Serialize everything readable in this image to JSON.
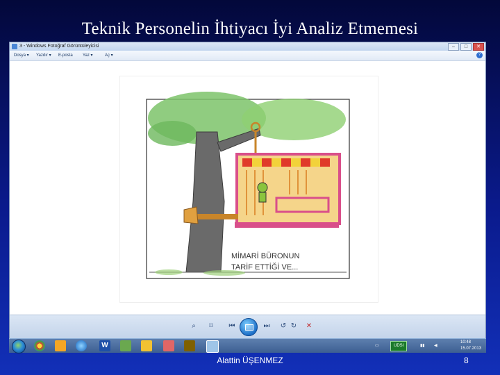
{
  "slide": {
    "title": "Teknik Personelin İhtiyacı İyi Analiz Etmemesi",
    "author": "Alattin ÜŞENMEZ",
    "page_number": "8"
  },
  "window": {
    "title": "3 - Windows Fotoğraf Görüntüleyicisi",
    "menu": [
      {
        "label": "Dosya ▾"
      },
      {
        "label": "Yazdır ▾"
      },
      {
        "label": "E-posta"
      },
      {
        "label": "Yaz ▾"
      },
      {
        "label": "Aç ▾"
      }
    ]
  },
  "photo": {
    "caption_line1": "MİMARİ BÜRONUN",
    "caption_line2": "TARİF ETTİĞİ VE..."
  },
  "taskbar": {
    "tray_badge": "UDSI",
    "clock_time": "10:48",
    "clock_date": "15.07.2013"
  },
  "colors": {
    "slide_bg_top": "#03083a",
    "slide_bg_bottom": "#1230b8",
    "canopy": "#7cc36a",
    "trunk": "#5a5a5a",
    "house_frame": "#d94f8a",
    "house_wall": "#f0b84a",
    "awning_red": "#e03a2a",
    "awning_yellow": "#f2d23a"
  }
}
